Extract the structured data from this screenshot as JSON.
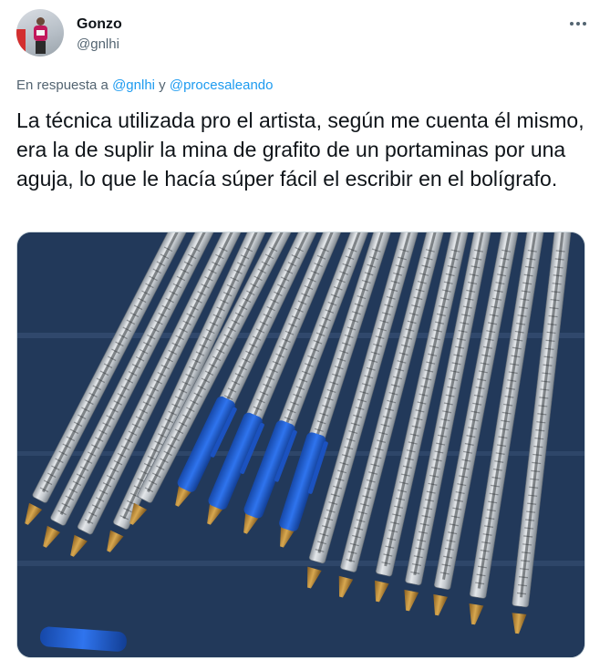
{
  "author": {
    "name": "Gonzo",
    "handle": "@gnlhi"
  },
  "reply": {
    "prefix": "En respuesta a ",
    "mention1": "@gnlhi",
    "connector": " y ",
    "mention2": "@procesaleando"
  },
  "tweet": {
    "text": "La técnica utilizada pro el artista, según me cuenta él mismo, era la de suplir la mina de grafito de un portaminas por una aguja, lo que le hacía súper fácil el escribir en el bolígrafo."
  },
  "media": {
    "description_icon": "photo-of-engraved-ballpoint-pens",
    "colors": {
      "background": "#243c5a",
      "pen_barrel": "#c9ccd0",
      "cap_blue": "#1f5fd6",
      "tip_brass": "#b9842f"
    }
  },
  "icons": {
    "more": "more-horizontal-icon"
  }
}
